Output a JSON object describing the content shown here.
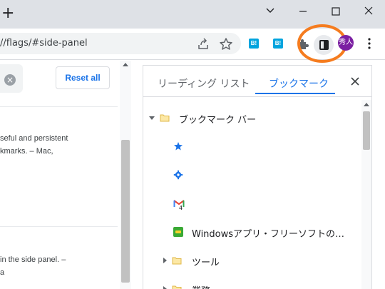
{
  "window": {
    "new_tab_glyph": "+"
  },
  "toolbar": {
    "url": "//flags/#side-panel",
    "ext_1_label": "B!",
    "ext_2_label": "B!",
    "avatar_text": "秀人",
    "accent_color": "#1a73e8",
    "highlight_color": "#f57c1f"
  },
  "flags_page": {
    "reset_label": "Reset all",
    "clear_glyph": "×",
    "desc_1_line_1": "seful and persistent",
    "desc_1_line_2": "kmarks. – Mac,",
    "desc_2_line_1": "in the side panel. –",
    "desc_2_line_2": "a"
  },
  "side_panel": {
    "tabs": [
      {
        "label": "リーディング リスト",
        "active": false
      },
      {
        "label": "ブックマーク",
        "active": true
      }
    ],
    "bookmarks": [
      {
        "label": "ブックマーク バー",
        "type": "folder",
        "expanded": true,
        "icon": "folder-icon"
      },
      {
        "label": "",
        "type": "bookmark",
        "icon": "star-favicon"
      },
      {
        "label": "",
        "type": "bookmark",
        "icon": "gear-favicon"
      },
      {
        "label": "",
        "type": "bookmark",
        "icon": "gmail-favicon",
        "badge": "4"
      },
      {
        "label": "Windowsアプリ・フリーソフトの…",
        "type": "bookmark",
        "icon": "green-favicon"
      },
      {
        "label": "ツール",
        "type": "folder",
        "expanded": false,
        "icon": "folder-icon"
      },
      {
        "label": "業務",
        "type": "folder",
        "expanded": false,
        "icon": "folder-icon"
      }
    ]
  }
}
